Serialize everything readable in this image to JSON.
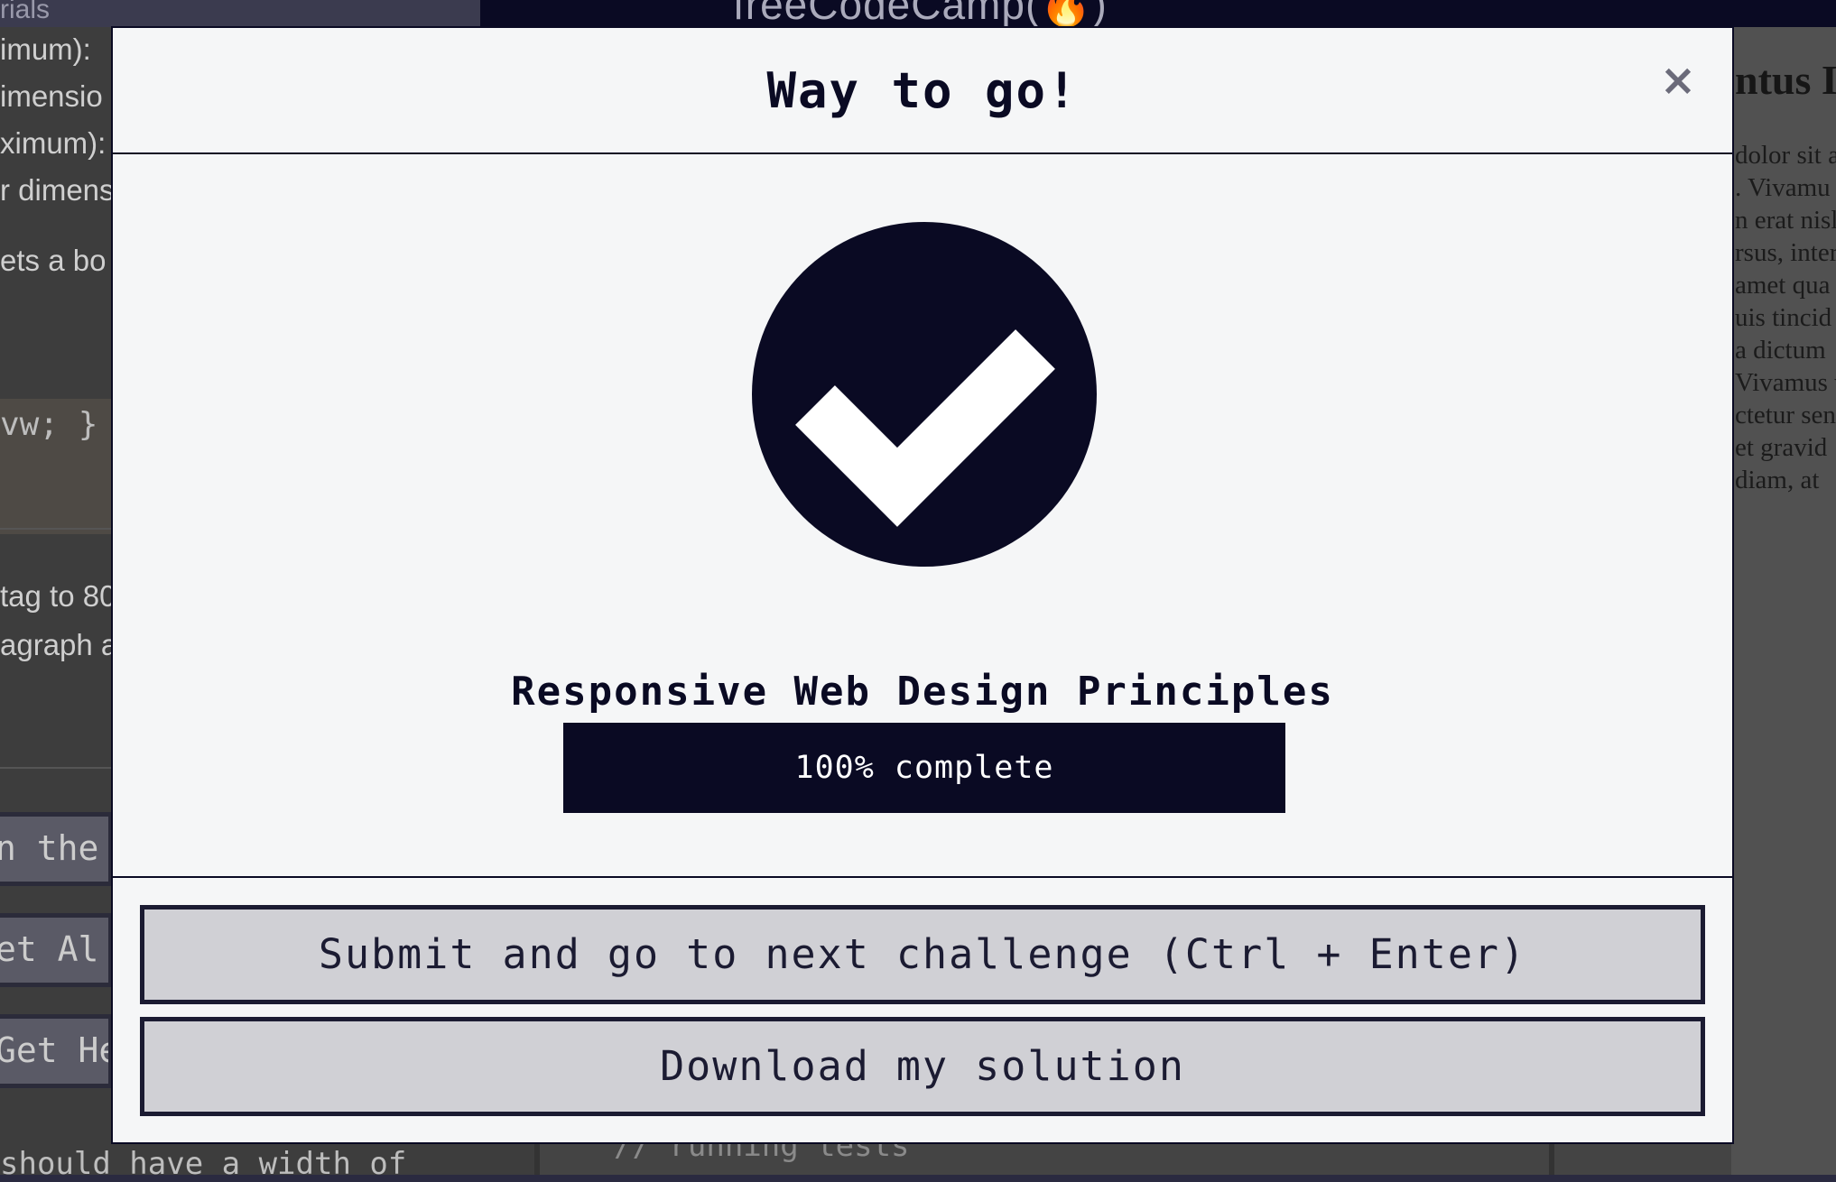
{
  "background": {
    "nav_tutorials": "rials",
    "brand": "freeCodeCamp(🔥)",
    "left_lines": [
      "imum):",
      "imensio",
      "ximum):",
      "r dimens",
      "ets a bo"
    ],
    "code_snippet": "vw; }",
    "left_lines2": [
      "tag to 80",
      "agraph a"
    ],
    "buttons": [
      "n the",
      "et Al",
      "Get He"
    ],
    "footer_text": "should have a width of",
    "console_text": "// running tests",
    "preview_heading": "ntus Ip",
    "preview_lines": [
      "dolor sit a",
      ". Vivamu",
      "n erat nisl",
      "rsus, inter",
      "amet qua",
      "uis tincid",
      "a dictum",
      "Vivamus v",
      "ctetur sen",
      " et gravid",
      " diam, at"
    ]
  },
  "modal": {
    "title": "Way to go!",
    "close_label": "×",
    "icon": "checkmark-circle-icon",
    "certification": "Responsive Web Design Principles",
    "progress": {
      "percent": 100,
      "label": "100% complete"
    },
    "buttons": {
      "submit": "Submit and go to next challenge (Ctrl + Enter)",
      "download": "Download my solution"
    }
  },
  "colors": {
    "primary": "#0a0a23",
    "modal_bg": "#f5f6f7",
    "button_bg": "#d0d0d5"
  }
}
